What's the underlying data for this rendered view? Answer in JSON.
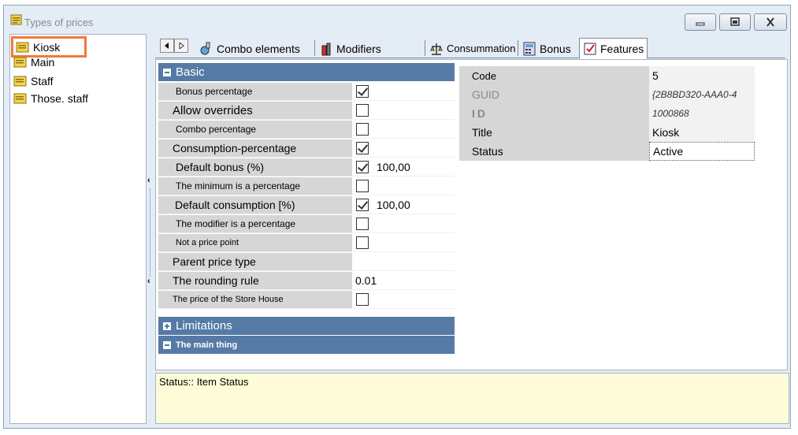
{
  "window": {
    "title": "Types of prices",
    "controls": {
      "minimize_icon": "minimize-icon",
      "maximize_icon": "maximize-icon",
      "close_icon": "close-icon"
    }
  },
  "tree": {
    "items": [
      {
        "label": "Kiosk",
        "icon": "folder-icon",
        "selected": true
      },
      {
        "label": "Main",
        "icon": "folder-icon"
      },
      {
        "label": "Staff",
        "icon": "folder-icon"
      },
      {
        "label": "Those. staff",
        "icon": "folder-icon"
      }
    ]
  },
  "tabs": [
    {
      "label": "Combo elements",
      "icon": "combo-icon"
    },
    {
      "label": "Modifiers",
      "icon": "bottle-icon"
    },
    {
      "label": "Consummation",
      "icon": "scale-icon"
    },
    {
      "label": "Bonus",
      "icon": "calculator-icon"
    },
    {
      "label": "Features",
      "icon": "checklist-icon",
      "active": true
    }
  ],
  "grid": {
    "categories": {
      "basic": "Basic",
      "limitations": "Limitations",
      "main_thing": "The main thing"
    },
    "rows": [
      {
        "label": "Bonus percentage",
        "checked": true,
        "value": ""
      },
      {
        "label": "Allow overrides",
        "checked": false,
        "value": ""
      },
      {
        "label": "Combo percentage",
        "checked": false,
        "value": ""
      },
      {
        "label": "Consumption-percentage",
        "checked": true,
        "value": ""
      },
      {
        "label": "Default bonus (%)",
        "checked": true,
        "value": "100,00"
      },
      {
        "label": "The minimum is a percentage",
        "checked": false,
        "value": ""
      },
      {
        "label": "Default consumption [%)",
        "checked": true,
        "value": "100,00"
      },
      {
        "label": "The modifier is a percentage",
        "checked": false,
        "value": ""
      },
      {
        "label": "Not a price point",
        "checked": false,
        "value": ""
      },
      {
        "label": "Parent price type",
        "checked": null,
        "value": ""
      },
      {
        "label": "The rounding rule",
        "checked": null,
        "value": "0.01"
      },
      {
        "label": "The price of the Store House",
        "checked": false,
        "value": ""
      }
    ]
  },
  "properties": [
    {
      "label": "Code",
      "value": "5"
    },
    {
      "label": "GUID",
      "value": "{2B8BD320-AAA0-4"
    },
    {
      "label": "ID",
      "value": "1000868"
    },
    {
      "label": "Title",
      "value": "Kiosk"
    },
    {
      "label": "Status",
      "value": "Active"
    }
  ],
  "status": {
    "text": "Status:: Item Status"
  },
  "colors": {
    "category_bg": "#557aa6",
    "status_bg": "#fefcd8",
    "selection_border": "#f07a3a"
  }
}
